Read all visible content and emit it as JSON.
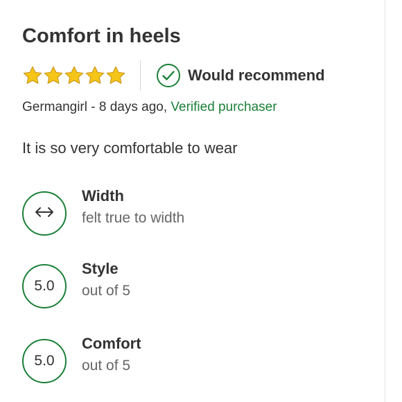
{
  "review": {
    "title": "Comfort in heels",
    "rating": 5,
    "rating_max": 5,
    "recommend_label": "Would recommend",
    "author": "Germangirl",
    "separator": " - ",
    "date": "8 days ago,",
    "verified_label": "Verified purchaser",
    "body": "It is so very comfortable to wear"
  },
  "attributes": [
    {
      "label": "Width",
      "value": "",
      "icon": "double-arrow-icon",
      "description": "felt true to width"
    },
    {
      "label": "Style",
      "value": "5.0",
      "description": "out of 5"
    },
    {
      "label": "Comfort",
      "value": "5.0",
      "description": "out of 5"
    }
  ],
  "colors": {
    "star": "#f5c518",
    "star_outline": "#c8961a",
    "accent_green": "#1a7f37",
    "text_primary": "#333333",
    "text_secondary": "#666666"
  }
}
